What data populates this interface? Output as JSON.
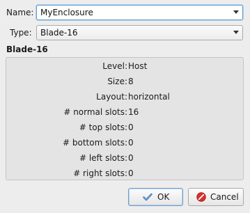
{
  "form": {
    "name_label": "Name:",
    "name_value": "MyEnclosure",
    "type_label": "Type:",
    "type_value": "Blade-16"
  },
  "details": {
    "title": "Blade-16",
    "properties": [
      {
        "key": "Level:",
        "value": "Host"
      },
      {
        "key": "Size:",
        "value": "8"
      },
      {
        "key": "Layout:",
        "value": "horizontal"
      },
      {
        "key": "# normal slots:",
        "value": "16"
      },
      {
        "key": "# top slots:",
        "value": "0"
      },
      {
        "key": "# bottom slots:",
        "value": "0"
      },
      {
        "key": "# left slots:",
        "value": "0"
      },
      {
        "key": "# right slots:",
        "value": "0"
      }
    ]
  },
  "buttons": {
    "ok_label": "OK",
    "cancel_label": "Cancel"
  },
  "icons": {
    "ok": "checkmark-icon",
    "cancel": "cancel-circle-icon",
    "combo_arrow": "chevron-down-icon"
  },
  "colors": {
    "focus_border": "#5b9bd5",
    "cancel_icon": "#d9302c",
    "ok_icon": "#3b6fb5"
  }
}
